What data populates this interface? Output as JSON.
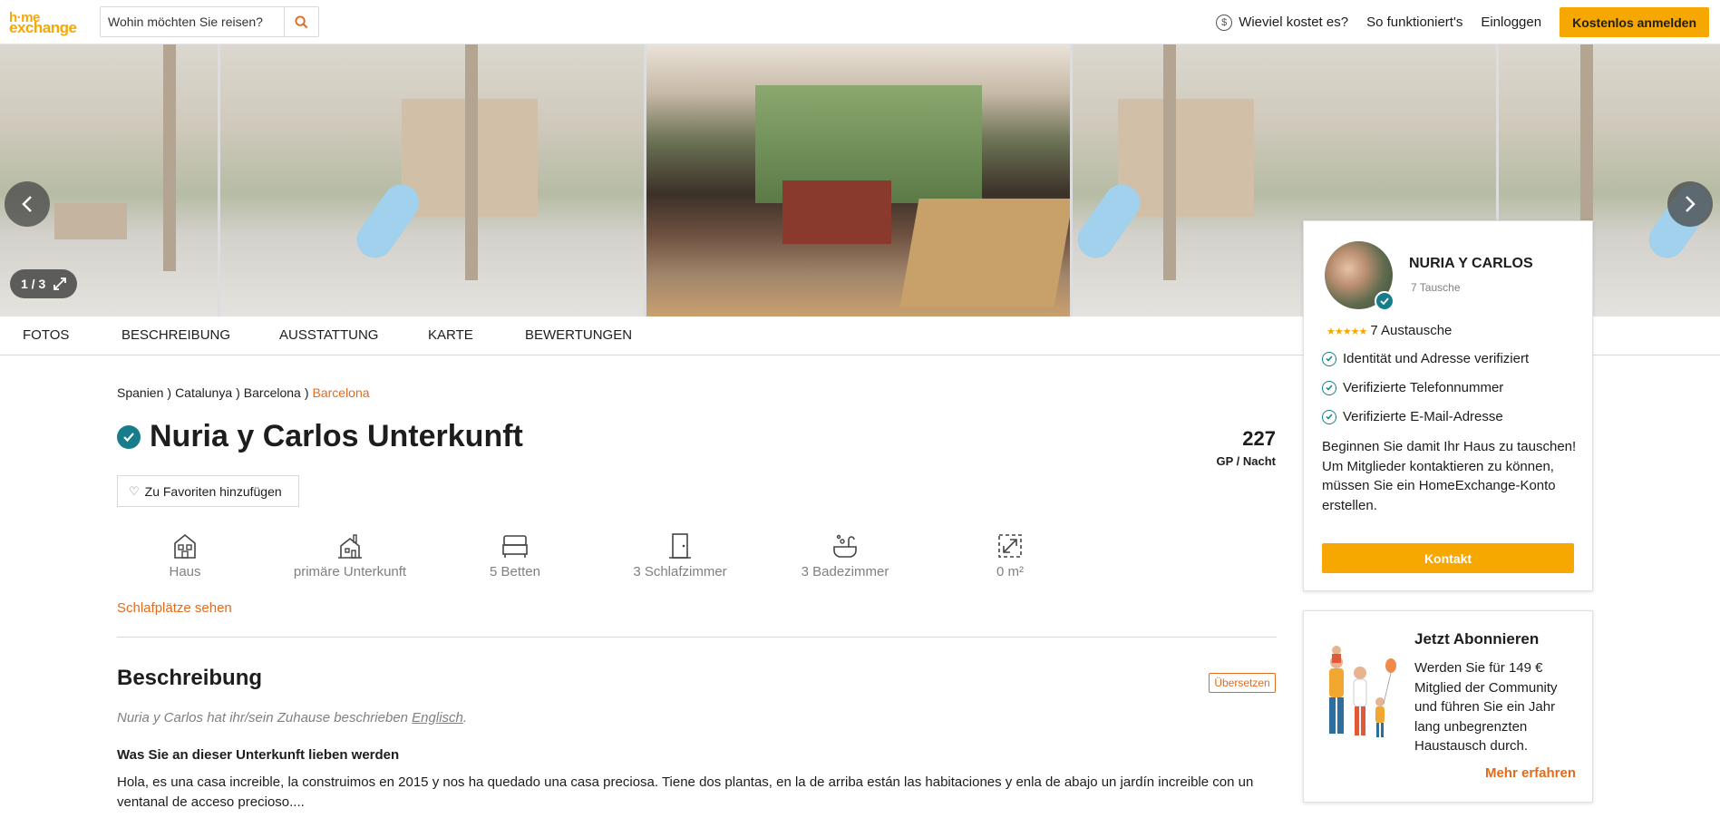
{
  "header": {
    "logo_line1": "h·me",
    "logo_line2": "exchange",
    "search_placeholder": "Wohin möchten Sie reisen?",
    "nav": {
      "cost": "Wieviel kostet es?",
      "how": "So funktioniert's",
      "login": "Einloggen",
      "signup": "Kostenlos anmelden"
    }
  },
  "gallery": {
    "counter": "1 / 3"
  },
  "tabs": [
    "FOTOS",
    "BESCHREIBUNG",
    "AUSSTATTUNG",
    "KARTE",
    "BEWERTUNGEN"
  ],
  "breadcrumb": [
    "Spanien",
    "Catalunya",
    "Barcelona",
    "Barcelona"
  ],
  "listing": {
    "title": "Nuria y Carlos Unterkunft",
    "price": "227",
    "price_unit": "GP / Nacht",
    "favorite": "Zu Favoriten hinzufügen",
    "features": [
      "Haus",
      "primäre Unterkunft",
      "5 Betten",
      "3 Schlafzimmer",
      "3 Badezimmer",
      "0 m²"
    ],
    "sleep_link": "Schlafplätze sehen"
  },
  "description": {
    "heading": "Beschreibung",
    "translate": "Übersetzen",
    "note_prefix": "Nuria y Carlos hat ihr/sein Zuhause beschrieben ",
    "note_lang": "Englisch",
    "note_suffix": ".",
    "love_heading": "Was Sie an dieser Unterkunft lieben werden",
    "text": "Hola, es una casa increible, la construimos en 2015 y nos ha quedado una casa preciosa. Tiene dos plantas, en la de arriba están las habitaciones y enla de abajo un jardín increible con un ventanal de acceso precioso...."
  },
  "host": {
    "name": "NURIA Y CARLOS",
    "exchanges_small": "7 Tausche",
    "stars": "★★★★★",
    "exchanges": "7 Austausche",
    "verifications": [
      "Identität und Adresse verifiziert",
      "Verifizierte Telefonnummer",
      "Verifizierte E-Mail-Adresse"
    ],
    "cta_text": "Beginnen Sie damit Ihr Haus zu tauschen!\nUm Mitglieder kontaktieren zu können, müssen Sie ein HomeExchange-Konto erstellen.",
    "cta_line1": "Beginnen Sie damit Ihr Haus zu tauschen!",
    "cta_line2": "Um Mitglieder kontaktieren zu können, müssen Sie ein HomeExchange-Konto erstellen.",
    "contact": "Kontakt"
  },
  "subscribe": {
    "heading": "Jetzt Abonnieren",
    "text": "Werden Sie für 149 € Mitglied der Community und führen Sie ein Jahr lang unbegrenzten Haustausch durch.",
    "link": "Mehr erfahren"
  },
  "colors": {
    "accent": "#f7a800",
    "link": "#e36b1e",
    "verified": "#177d8a"
  }
}
